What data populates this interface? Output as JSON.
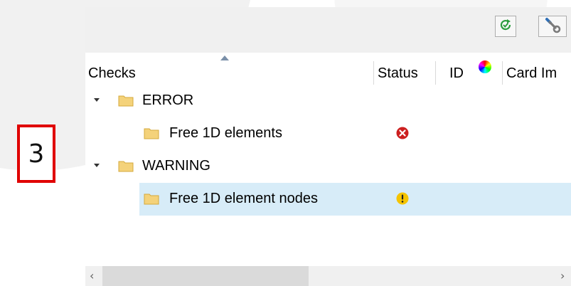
{
  "step_badge": {
    "number": "3"
  },
  "toolbar": {
    "buttons": [
      {
        "icon": "refresh-check-icon"
      },
      {
        "icon": "wrench-icon"
      }
    ]
  },
  "table": {
    "columns": [
      "Checks",
      "Status",
      "ID",
      "Card Im"
    ],
    "id_column_icon": "color-wheel-icon",
    "sort": {
      "column": "Checks",
      "direction": "ascending"
    }
  },
  "tree": [
    {
      "label": "ERROR",
      "expanded": true,
      "icon": "folder-icon",
      "children": [
        {
          "label": "Free 1D elements",
          "icon": "folder-icon",
          "status": "error"
        }
      ]
    },
    {
      "label": "WARNING",
      "expanded": true,
      "icon": "folder-icon",
      "children": [
        {
          "label": "Free 1D element nodes",
          "icon": "folder-icon",
          "status": "warning",
          "selected": true
        }
      ]
    }
  ],
  "colors": {
    "badge_border": "#e00000",
    "selection": "#d7ecf8",
    "error": "#cc1f1f",
    "warning": "#f5c400",
    "folder": "#f4d27a"
  },
  "scrollbar": {
    "left_arrow": "‹",
    "right_arrow": "›"
  }
}
